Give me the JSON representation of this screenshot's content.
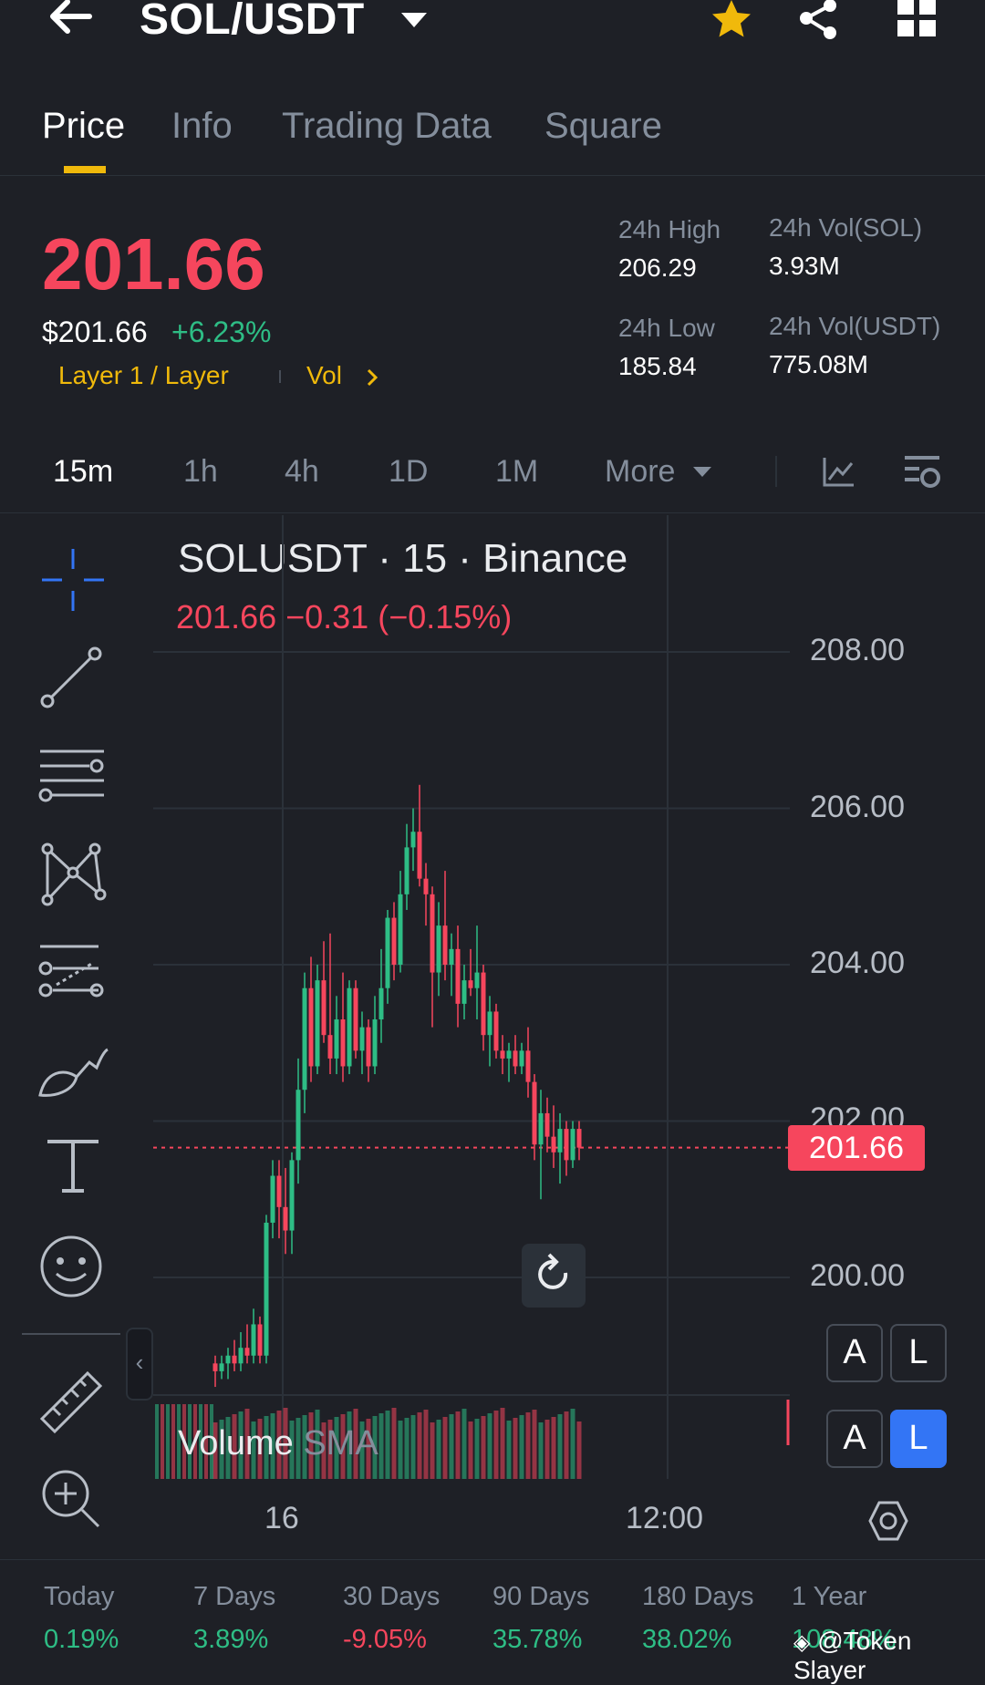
{
  "header": {
    "title": "SOL/USDT"
  },
  "tabs": [
    {
      "label": "Price",
      "active": true
    },
    {
      "label": "Info"
    },
    {
      "label": "Trading Data"
    },
    {
      "label": "Square"
    }
  ],
  "ticker": {
    "price": "201.66",
    "usd_price": "$201.66",
    "change_pct": "+6.23%",
    "tag_layer": "Layer 1 / Layer",
    "tag_vol": "Vol",
    "high_label": "24h High",
    "high_value": "206.29",
    "low_label": "24h Low",
    "low_value": "185.84",
    "vol_sol_label": "24h Vol(SOL)",
    "vol_sol_value": "3.93M",
    "vol_usdt_label": "24h Vol(USDT)",
    "vol_usdt_value": "775.08M"
  },
  "timeframes": [
    {
      "label": "15m",
      "active": true
    },
    {
      "label": "1h"
    },
    {
      "label": "4h"
    },
    {
      "label": "1D"
    },
    {
      "label": "1M"
    },
    {
      "label": "More"
    }
  ],
  "chart": {
    "title": "SOLUSDT · 15 · Binance",
    "subtitle": "201.66  −0.31 (−0.15%)",
    "last_price_tag": "201.66",
    "volume_label": "Volume",
    "volume_sma": "SMA",
    "y_ticks": [
      "208.00",
      "206.00",
      "204.00",
      "202.00",
      "200.00"
    ],
    "x_ticks": [
      "16",
      "12:00"
    ],
    "btn_a1": "A",
    "btn_l1": "L",
    "btn_a2": "A",
    "btn_l2": "L"
  },
  "chart_data": {
    "type": "candlestick",
    "ylim": [
      198,
      208.5
    ],
    "last_price": 201.66,
    "y_ticks": [
      208,
      206,
      204,
      202,
      200
    ],
    "x_ticks": [
      "16",
      "12:00"
    ],
    "candles": [
      [
        198.9,
        199.0,
        198.6,
        198.8
      ],
      [
        198.8,
        199.0,
        198.7,
        198.9
      ],
      [
        198.9,
        199.1,
        198.7,
        199.0
      ],
      [
        199.0,
        199.2,
        198.8,
        198.9
      ],
      [
        198.9,
        199.3,
        198.8,
        199.1
      ],
      [
        199.1,
        199.4,
        198.9,
        199.0
      ],
      [
        199.0,
        199.6,
        198.9,
        199.4
      ],
      [
        199.4,
        199.5,
        198.9,
        199.0
      ],
      [
        199.0,
        200.8,
        198.9,
        200.7
      ],
      [
        200.7,
        201.5,
        200.5,
        201.3
      ],
      [
        201.3,
        201.5,
        200.5,
        200.9
      ],
      [
        200.9,
        201.4,
        200.3,
        200.6
      ],
      [
        200.6,
        201.6,
        200.3,
        201.5
      ],
      [
        201.5,
        202.8,
        201.2,
        202.4
      ],
      [
        202.4,
        203.9,
        202.1,
        203.7
      ],
      [
        203.7,
        204.1,
        202.5,
        202.7
      ],
      [
        202.7,
        204.0,
        202.6,
        203.8
      ],
      [
        203.8,
        204.3,
        203.0,
        203.1
      ],
      [
        203.1,
        204.4,
        202.6,
        202.8
      ],
      [
        202.8,
        203.6,
        202.6,
        203.3
      ],
      [
        203.3,
        203.9,
        202.5,
        202.7
      ],
      [
        202.7,
        203.8,
        202.6,
        203.7
      ],
      [
        203.7,
        203.8,
        202.8,
        202.9
      ],
      [
        202.9,
        203.4,
        202.6,
        203.2
      ],
      [
        203.2,
        203.3,
        202.5,
        202.7
      ],
      [
        202.7,
        203.6,
        202.6,
        203.3
      ],
      [
        203.3,
        204.2,
        203.0,
        203.7
      ],
      [
        203.7,
        204.7,
        203.5,
        204.6
      ],
      [
        204.6,
        204.8,
        203.8,
        204.0
      ],
      [
        204.0,
        205.2,
        203.9,
        204.9
      ],
      [
        204.9,
        205.8,
        204.7,
        205.5
      ],
      [
        205.5,
        206.0,
        205.2,
        205.7
      ],
      [
        205.7,
        206.3,
        205.0,
        205.1
      ],
      [
        205.1,
        205.3,
        204.5,
        204.9
      ],
      [
        204.9,
        205.0,
        203.2,
        203.9
      ],
      [
        203.9,
        204.8,
        203.6,
        204.5
      ],
      [
        204.5,
        205.2,
        203.8,
        204.0
      ],
      [
        204.0,
        204.4,
        203.6,
        204.2
      ],
      [
        204.2,
        204.5,
        203.2,
        203.5
      ],
      [
        203.5,
        204.0,
        203.3,
        203.8
      ],
      [
        203.8,
        204.2,
        203.6,
        203.7
      ],
      [
        203.7,
        204.5,
        203.3,
        203.9
      ],
      [
        203.9,
        204.0,
        202.9,
        203.1
      ],
      [
        203.1,
        203.6,
        202.7,
        203.4
      ],
      [
        203.4,
        203.5,
        202.8,
        202.9
      ],
      [
        202.9,
        203.1,
        202.6,
        202.8
      ],
      [
        202.8,
        203.0,
        202.5,
        202.9
      ],
      [
        202.9,
        203.1,
        202.6,
        202.7
      ],
      [
        202.7,
        203.0,
        202.6,
        202.9
      ],
      [
        202.9,
        203.2,
        202.3,
        202.5
      ],
      [
        202.5,
        202.6,
        201.5,
        201.7
      ],
      [
        201.7,
        202.4,
        201.0,
        202.1
      ],
      [
        202.1,
        202.3,
        201.6,
        201.8
      ],
      [
        201.8,
        202.2,
        201.4,
        201.6
      ],
      [
        201.6,
        202.1,
        201.2,
        201.9
      ],
      [
        201.9,
        202.0,
        201.3,
        201.5
      ],
      [
        201.5,
        202.0,
        201.4,
        201.9
      ],
      [
        201.9,
        202.0,
        201.5,
        201.66
      ]
    ]
  },
  "performance": [
    {
      "label": "Today",
      "value": "0.19%",
      "dir": "up"
    },
    {
      "label": "7 Days",
      "value": "3.89%",
      "dir": "up"
    },
    {
      "label": "30 Days",
      "value": "-9.05%",
      "dir": "down"
    },
    {
      "label": "90 Days",
      "value": "35.78%",
      "dir": "up"
    },
    {
      "label": "180 Days",
      "value": "38.02%",
      "dir": "up"
    },
    {
      "label": "1 Year",
      "value": "108.48%",
      "dir": "up"
    }
  ],
  "watermark": "@Token Slayer",
  "colors": {
    "up": "#2ebd85",
    "down": "#f6465d",
    "accent": "#f0b90b",
    "bg": "#1e2026"
  }
}
